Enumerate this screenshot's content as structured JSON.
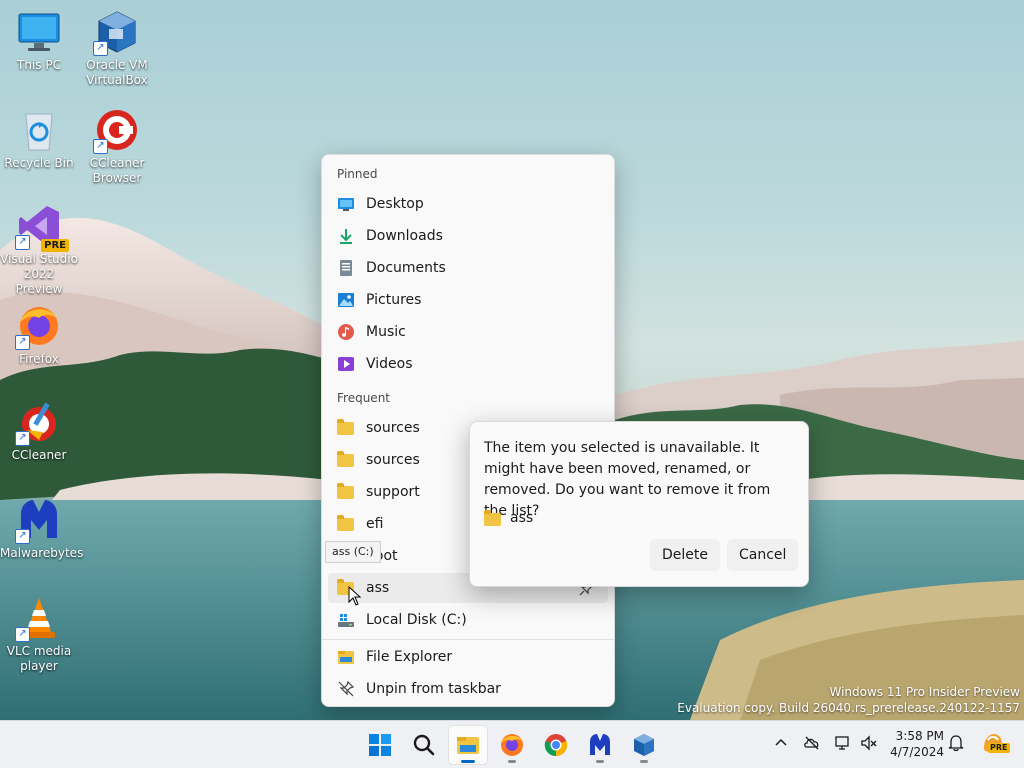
{
  "desktop": {
    "icons": [
      {
        "id": "this-pc",
        "label": "This PC"
      },
      {
        "id": "virtualbox",
        "label": "Oracle VM VirtualBox"
      },
      {
        "id": "recycle-bin",
        "label": "Recycle Bin"
      },
      {
        "id": "ccleaner-browser",
        "label": "CCleaner Browser"
      },
      {
        "id": "visual-studio",
        "label": "Visual Studio 2022 Preview",
        "badge": "PRE"
      },
      {
        "id": "firefox",
        "label": "Firefox"
      },
      {
        "id": "ccleaner",
        "label": "CCleaner"
      },
      {
        "id": "malwarebytes",
        "label": "Malwarebytes"
      },
      {
        "id": "vlc",
        "label": "VLC media player"
      }
    ]
  },
  "jumplist": {
    "pinned_heading": "Pinned",
    "pinned": [
      {
        "label": "Desktop",
        "icon": "desktop-icon"
      },
      {
        "label": "Downloads",
        "icon": "download-icon"
      },
      {
        "label": "Documents",
        "icon": "document-icon"
      },
      {
        "label": "Pictures",
        "icon": "picture-icon"
      },
      {
        "label": "Music",
        "icon": "music-icon"
      },
      {
        "label": "Videos",
        "icon": "video-icon"
      }
    ],
    "frequent_heading": "Frequent",
    "frequent": [
      {
        "label": "sources",
        "icon": "folder-icon"
      },
      {
        "label": "sources",
        "icon": "folder-icon"
      },
      {
        "label": "support",
        "icon": "folder-icon"
      },
      {
        "label": "efi",
        "icon": "folder-icon"
      },
      {
        "label": "boot",
        "icon": "folder-icon"
      },
      {
        "label": "ass",
        "icon": "folder-icon"
      },
      {
        "label": "Local Disk (C:)",
        "icon": "drive-icon"
      }
    ],
    "actions": [
      {
        "label": "File Explorer",
        "icon": "file-explorer-icon"
      },
      {
        "label": "Unpin from taskbar",
        "icon": "unpin-icon"
      }
    ],
    "tooltip": "ass (C:)"
  },
  "dialog": {
    "message": "The item you selected is unavailable. It might have been moved, renamed, or removed. Do you want to remove it from the list?",
    "item": "ass",
    "delete_label": "Delete",
    "cancel_label": "Cancel"
  },
  "watermark": {
    "line1": "Windows 11 Pro Insider Preview",
    "line2": "Evaluation copy. Build 26040.rs_prerelease.240122-1157"
  },
  "taskbar": {
    "apps": [
      "start-icon",
      "search-icon",
      "file-explorer-icon",
      "firefox-icon",
      "chrome-icon",
      "malwarebytes-icon",
      "virtualbox-icon"
    ],
    "time": "3:58 PM",
    "date": "4/7/2024",
    "copilot_badge": "PRE"
  }
}
